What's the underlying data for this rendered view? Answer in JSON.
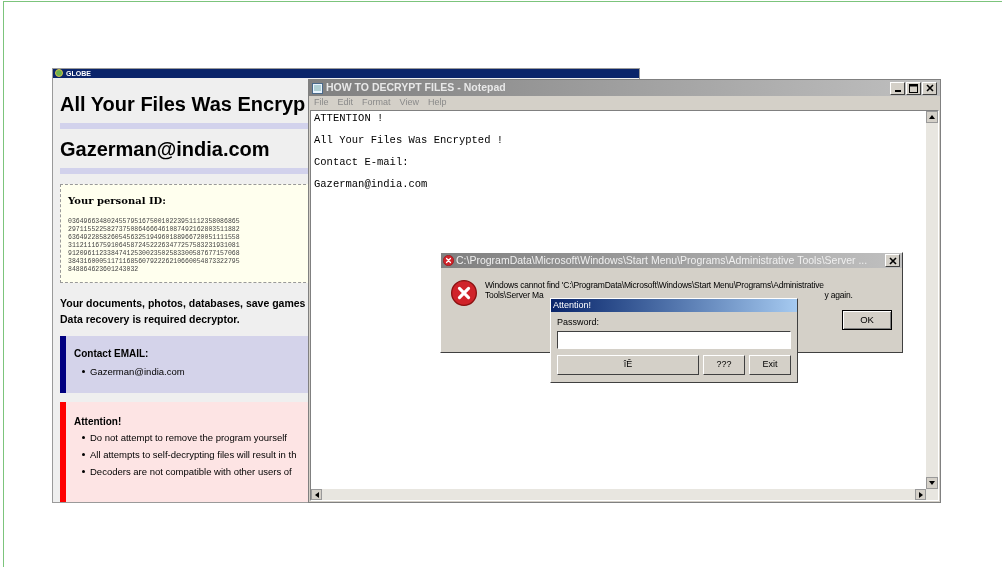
{
  "globe_window": {
    "title": "GLOBE",
    "heading": "All Your Files Was Encryp",
    "email_heading": "Gazerman@india.com",
    "personal_id": {
      "label": "Your personal ID:",
      "lines": [
        "03649663480245579516750010223951112358086865",
        "29711552258273750864666461087492162803511882",
        "63649228582605456325194960188966720051111558",
        "31121116759106458724522263477257583231931081",
        "91209611233847412530023502583300587677157068",
        "38431600051171168560792226210660054873322795",
        "848864623601243032"
      ]
    },
    "message_lines": [
      "Your documents, photos, databases, save games",
      "Data recovery is required decryptor."
    ],
    "contact": {
      "title": "Contact EMAIL:",
      "items": [
        "Gazerman@india.com"
      ]
    },
    "attention": {
      "title": "Attention!",
      "items": [
        "Do not attempt to remove the program yourself",
        "All attempts to self-decrypting files will result in th",
        "Decoders are not compatible with other users of"
      ]
    }
  },
  "notepad": {
    "title": "HOW TO DECRYPT FILES - Notepad",
    "menu": [
      "File",
      "Edit",
      "Format",
      "View",
      "Help"
    ],
    "lines": [
      "ATTENTION !",
      "All Your Files Was Encrypted !",
      "Contact E-mail:",
      "Gazerman@india.com"
    ]
  },
  "error_dialog": {
    "title": "C:\\ProgramData\\Microsoft\\Windows\\Start Menu\\Programs\\Administrative Tools\\Server ...",
    "message_line_1": "Windows cannot find 'C:\\ProgramData\\Microsoft\\Windows\\Start Menu\\Programs\\Administrative",
    "message_line_2_start": "Tools\\Server Ma",
    "message_line_2_end": "y again.",
    "button": "OK"
  },
  "password_dialog": {
    "title": "Attention!",
    "field_label": "Password:",
    "buttons": [
      "îÊ",
      "???",
      "Exit"
    ]
  }
}
